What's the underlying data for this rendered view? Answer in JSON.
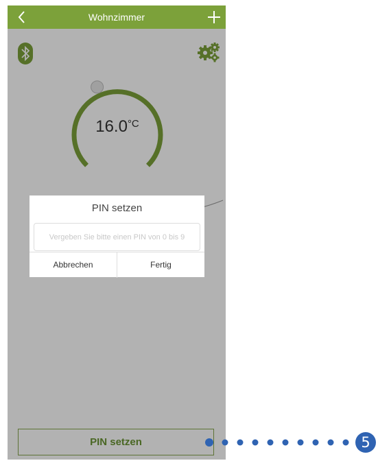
{
  "header": {
    "title": "Wohnzimmer",
    "back_icon": "chevron-left-icon",
    "add_icon": "plus-icon"
  },
  "status_icons": [
    "bluetooth-icon",
    "settings-gears-icon"
  ],
  "thermostat": {
    "temperature": "16.0",
    "unit": "°C"
  },
  "dialog": {
    "title": "PIN setzen",
    "input_placeholder": "Vergeben Sie bitte einen PIN von 0 bis 9",
    "cancel_label": "Abbrechen",
    "confirm_label": "Fertig"
  },
  "footer": {
    "pin_button_label": "PIN setzen"
  },
  "annotation": {
    "number": "5"
  },
  "colors": {
    "accent": "#7ca13a",
    "callout": "#2f63b2"
  }
}
